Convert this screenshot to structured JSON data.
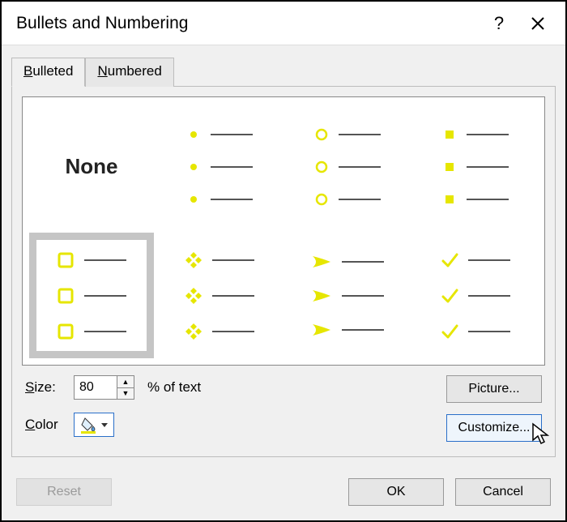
{
  "title": "Bullets and Numbering",
  "titlebar": {
    "help": "?",
    "close": "✕"
  },
  "tabs": {
    "bulleted": "Bulleted",
    "numbered": "Numbered",
    "active": "Bulleted"
  },
  "grid": {
    "none": "None",
    "cells": [
      {
        "kind": "none"
      },
      {
        "kind": "dot"
      },
      {
        "kind": "ring"
      },
      {
        "kind": "square-solid"
      },
      {
        "kind": "square-outline",
        "selected": true
      },
      {
        "kind": "diamond4"
      },
      {
        "kind": "arrowhead"
      },
      {
        "kind": "check"
      }
    ]
  },
  "size": {
    "label": "Size:",
    "value": "80",
    "suffix": "% of text"
  },
  "color": {
    "label": "Color",
    "value": "#e6e600"
  },
  "buttons": {
    "picture": "Picture...",
    "customize": "Customize...",
    "reset": "Reset",
    "ok": "OK",
    "cancel": "Cancel"
  }
}
